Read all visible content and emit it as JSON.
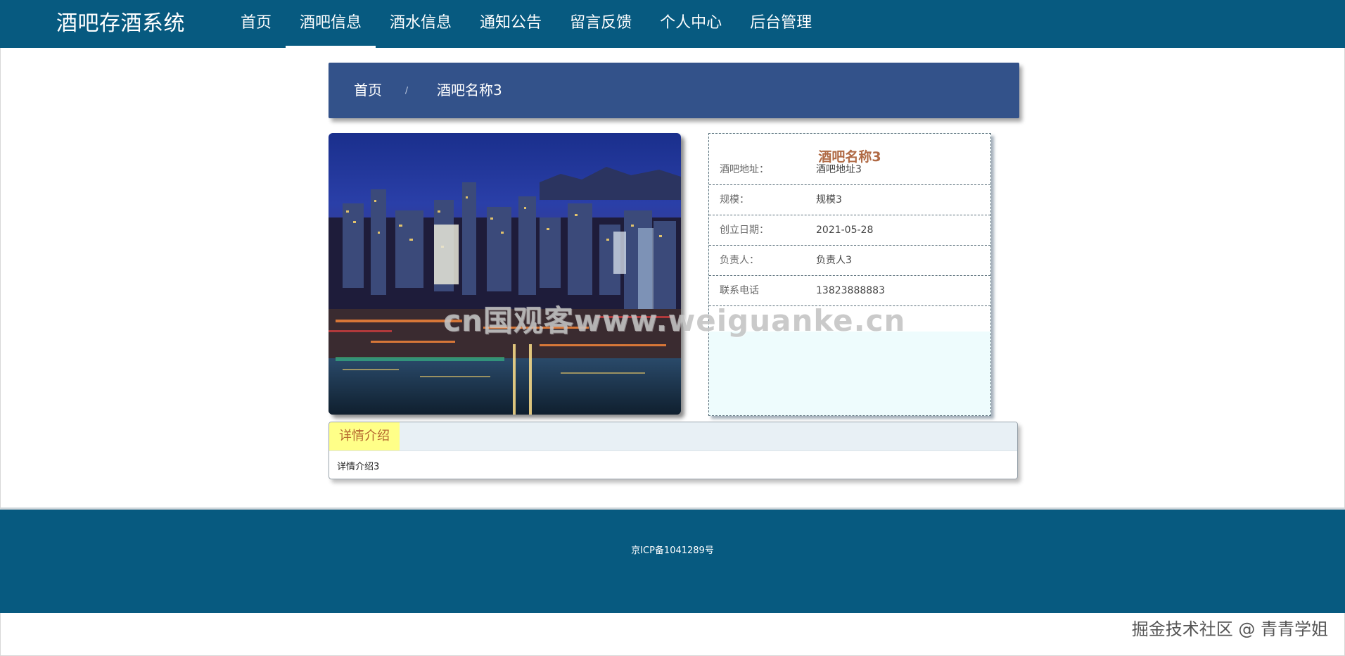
{
  "app": {
    "brand": "酒吧存酒系统"
  },
  "nav": {
    "items": [
      {
        "label": "首页",
        "active": false
      },
      {
        "label": "酒吧信息",
        "active": true
      },
      {
        "label": "酒水信息",
        "active": false
      },
      {
        "label": "通知公告",
        "active": false
      },
      {
        "label": "留言反馈",
        "active": false
      },
      {
        "label": "个人中心",
        "active": false
      },
      {
        "label": "后台管理",
        "active": false
      }
    ]
  },
  "breadcrumb": {
    "home": "首页",
    "separator": "/",
    "current": "酒吧名称3"
  },
  "photo": {
    "subject": "city night skyline"
  },
  "info": {
    "title": "酒吧名称3",
    "rows": [
      {
        "label": "酒吧地址：",
        "value": "酒吧地址3"
      },
      {
        "label": "规模：",
        "value": "规模3"
      },
      {
        "label": "创立日期：",
        "value": "2021-05-28"
      },
      {
        "label": "负责人：",
        "value": "负责人3"
      },
      {
        "label": "联系电话",
        "value": "13823888883"
      }
    ]
  },
  "detail": {
    "tab_label": "详情介绍",
    "content": "详情介绍3"
  },
  "footer": {
    "icp": "京ICP备1041289号"
  },
  "watermarks": {
    "center": "cn国观客www.weiguanke.cn",
    "corner": "掘金技术社区 @ 青青学姐"
  },
  "colors": {
    "header_bg": "#075a80",
    "breadcrumb_bg": "#33528a",
    "title_accent": "#b06a45",
    "tab_highlight": "#ffff88"
  }
}
